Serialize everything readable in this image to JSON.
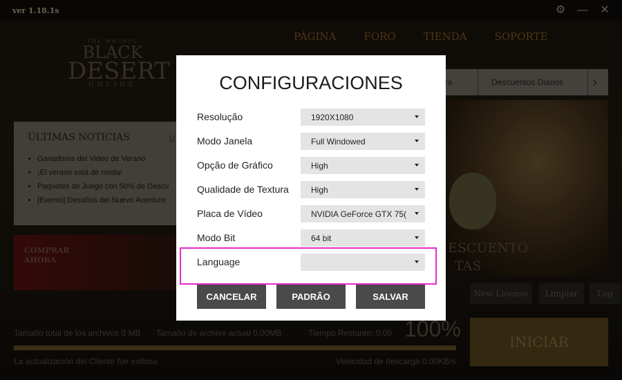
{
  "app": {
    "version": "ver 1.18.1s"
  },
  "window_controls": {
    "settings_icon": "gear-icon",
    "minimize_icon": "minimize-icon",
    "close_icon": "close-icon"
  },
  "nav": {
    "items": [
      "PÁGINA",
      "FORO",
      "TIENDA",
      "SOPORTE"
    ]
  },
  "logo": {
    "line_sub": "THE MMORPG",
    "line1": "BLACK",
    "line2": "DESERT",
    "line3": "ONLINE"
  },
  "news": {
    "title": "ÚLTIMAS NOTICIAS",
    "more": "Ú",
    "items": [
      "Ganadores del Video de Verano",
      "¡El verano está de moda!",
      "Paquetes de Juego con 50% de Descu",
      "[Evento] Desafíos del Nuevo Aventure"
    ]
  },
  "buy_banner": {
    "line1": "COMPRAR",
    "line2": "AHORA"
  },
  "tabs": {
    "items": [
      "era",
      "Descuentos Diarios"
    ],
    "next_icon": "chevron-right-icon"
  },
  "promo": {
    "line1": "ESCUENTO",
    "line2": "TAS"
  },
  "side_buttons": {
    "new_license": "New License",
    "limpiar": "Limpiar",
    "log": "Log"
  },
  "iniciar": "INICIAR",
  "status": {
    "total_size": "Tamaño total de los archivos 0 MB",
    "current_size": "Tamaño de archivo actual 0.00MB",
    "time_left": "Tiempo Restante: 0:00",
    "percent": "100%",
    "progress": 1.0,
    "update_message": "La actualización del Cliente fue exitosa",
    "download_speed": "Velocidad de descarga 0.00KB/s"
  },
  "dialog": {
    "title": "CONFIGURACIONES",
    "rows": [
      {
        "label": "Resolução",
        "value": "1920X1080"
      },
      {
        "label": "Modo Janela",
        "value": "Full Windowed"
      },
      {
        "label": "Opção de Gráfico",
        "value": "High"
      },
      {
        "label": "Qualidade de Textura",
        "value": "High"
      },
      {
        "label": "Placa de Vídeo",
        "value": "NVIDIA GeForce GTX 75("
      },
      {
        "label": "Modo Bit",
        "value": "64 bit"
      },
      {
        "label": "Language",
        "value": ""
      }
    ],
    "buttons": {
      "cancel": "CANCELAR",
      "default": "PADRÃO",
      "save": "SALVAR"
    },
    "highlight_color": "#e32ad0"
  }
}
